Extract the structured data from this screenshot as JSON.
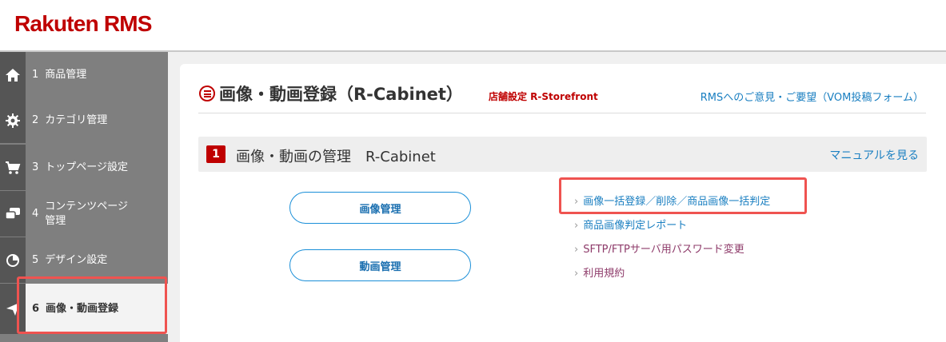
{
  "app": {
    "logo": "Rakuten RMS"
  },
  "sidebar": {
    "items": [
      {
        "num": "1",
        "label": "商品管理",
        "icon": "home-icon"
      },
      {
        "num": "2",
        "label": "カテゴリ管理",
        "icon": "gear-icon"
      },
      {
        "num": "3",
        "label": "トップページ設定",
        "icon": "cart-icon"
      },
      {
        "num": "4",
        "label": "コンテンツページ\n管理",
        "icon": "chat-icon"
      },
      {
        "num": "5",
        "label": "デザイン設定",
        "icon": "pie-chart-icon"
      },
      {
        "num": "6",
        "label": "画像・動画登録",
        "icon": "send-icon",
        "active": true
      }
    ]
  },
  "page": {
    "title": "画像・動画登録（R-Cabinet）",
    "subtitle": "店舗設定 R-Storefront",
    "feedback_link": "RMSへのご意見・ご要望（VOM投稿フォーム）"
  },
  "section": {
    "number": "1",
    "title": "画像・動画の管理　R-Cabinet",
    "manual_link": "マニュアルを見る"
  },
  "buttons": {
    "image_management": "画像管理",
    "video_management": "動画管理"
  },
  "links": [
    {
      "label": "画像一括登録／削除／商品画像一括判定",
      "color": "#1a7fc1"
    },
    {
      "label": "商品画像判定レポート",
      "color": "#1a7fc1"
    },
    {
      "label": "SFTP/FTPサーバ用パスワード変更",
      "color": "#8e3b6a"
    },
    {
      "label": "利用規約",
      "color": "#8e3b6a"
    }
  ]
}
